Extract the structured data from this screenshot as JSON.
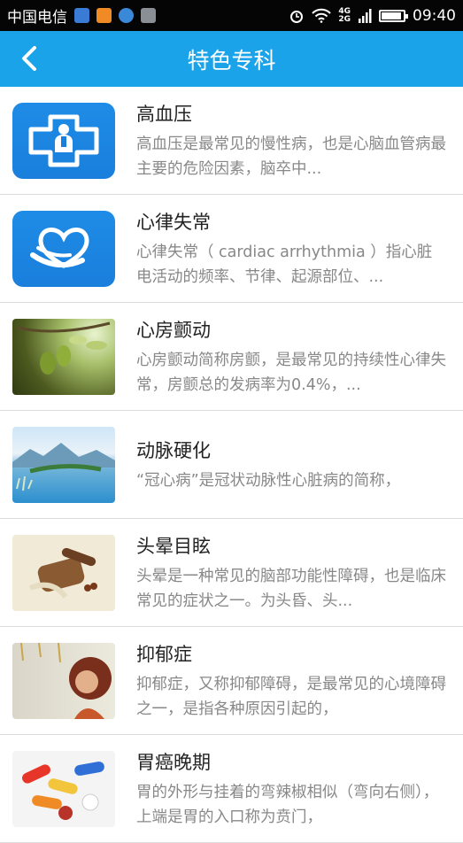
{
  "status": {
    "carrier": "中国电信",
    "time": "09:40",
    "network_top": "4G",
    "network_bottom": "2G",
    "icons": [
      "app-icon-blue",
      "app-icon-orange",
      "app-icon-round",
      "app-icon-gray",
      "alarm-icon",
      "wifi-icon",
      "signal-icon",
      "battery-icon"
    ]
  },
  "appbar": {
    "title": "特色专科",
    "back_icon": "back-arrow-icon"
  },
  "colors": {
    "statusbar": "#050505",
    "appbar": "#1aa3e8",
    "tile": "#1a7fdc"
  },
  "items": [
    {
      "title": "高血压",
      "desc": "高血压是最常见的慢性病，也是心脑血管病最主要的危险因素，脑卒中...",
      "thumb": "doctor-cross-icon"
    },
    {
      "title": "心律失常",
      "desc": "心律失常（ cardiac arrhythmia ）指心脏电活动的频率、节律、起源部位、...",
      "thumb": "heart-hand-icon"
    },
    {
      "title": "心房颤动",
      "desc": "心房颤动简称房颤，是最常见的持续性心律失常，房颤总的发病率为0.4%，...",
      "thumb": "olive-photo"
    },
    {
      "title": "动脉硬化",
      "desc": "“冠心病”是冠状动脉性心脏病的简称，",
      "thumb": "lake-photo"
    },
    {
      "title": "头晕目眩",
      "desc": "头晕是一种常见的脑部功能性障碍，也是临床常见的症状之一。为头昏、头...",
      "thumb": "herbs-photo"
    },
    {
      "title": "抑郁症",
      "desc": "抑郁症，又称抑郁障碍，是最常见的心境障碍之一，是指各种原因引起的，",
      "thumb": "woman-photo"
    },
    {
      "title": "胃癌晚期",
      "desc": "胃的外形与挂着的弯辣椒相似（弯向右侧），上端是胃的入口称为贲门，",
      "thumb": "pills-photo"
    }
  ]
}
